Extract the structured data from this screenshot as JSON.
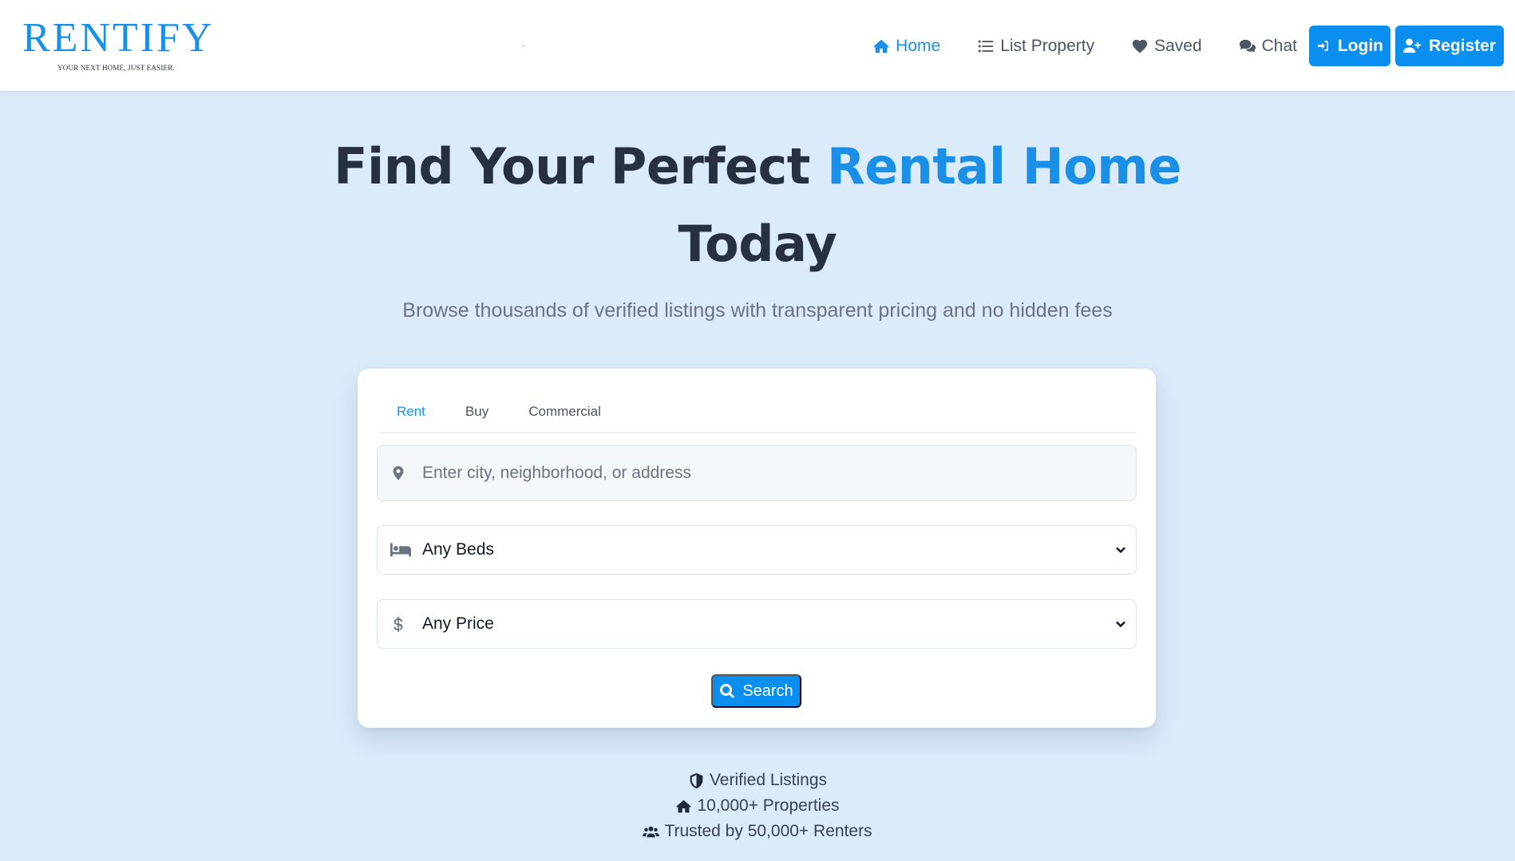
{
  "brand": {
    "name": "RENTIFY",
    "tagline": "YOUR NEXT HOME, JUST EASIER.",
    "accent_color": "#1a8fe8"
  },
  "nav": {
    "items": [
      {
        "label": "Home",
        "icon": "home-icon",
        "active": true
      },
      {
        "label": "List Property",
        "icon": "list-icon",
        "active": false
      },
      {
        "label": "Saved",
        "icon": "heart-icon",
        "active": false
      },
      {
        "label": "Chat",
        "icon": "chat-icon",
        "active": false
      }
    ],
    "login_label": "Login",
    "register_label": "Register",
    "button_color": "#0a8ef0"
  },
  "hero": {
    "title_part1": "Find Your Perfect ",
    "title_accent": "Rental Home",
    "title_part2": "Today",
    "subtitle": "Browse thousands of verified listings with transparent pricing and no hidden fees"
  },
  "search": {
    "tabs": [
      "Rent",
      "Buy",
      "Commercial"
    ],
    "active_tab": "Rent",
    "location_placeholder": "Enter city, neighborhood, or address",
    "location_value": "",
    "beds_value": "Any Beds",
    "price_value": "Any Price",
    "button_label": "Search"
  },
  "trust": [
    {
      "icon": "shield-icon",
      "label": "Verified Listings"
    },
    {
      "icon": "home-icon",
      "label": "10,000+ Properties"
    },
    {
      "icon": "users-icon",
      "label": "Trusted by 50,000+ Renters"
    }
  ]
}
